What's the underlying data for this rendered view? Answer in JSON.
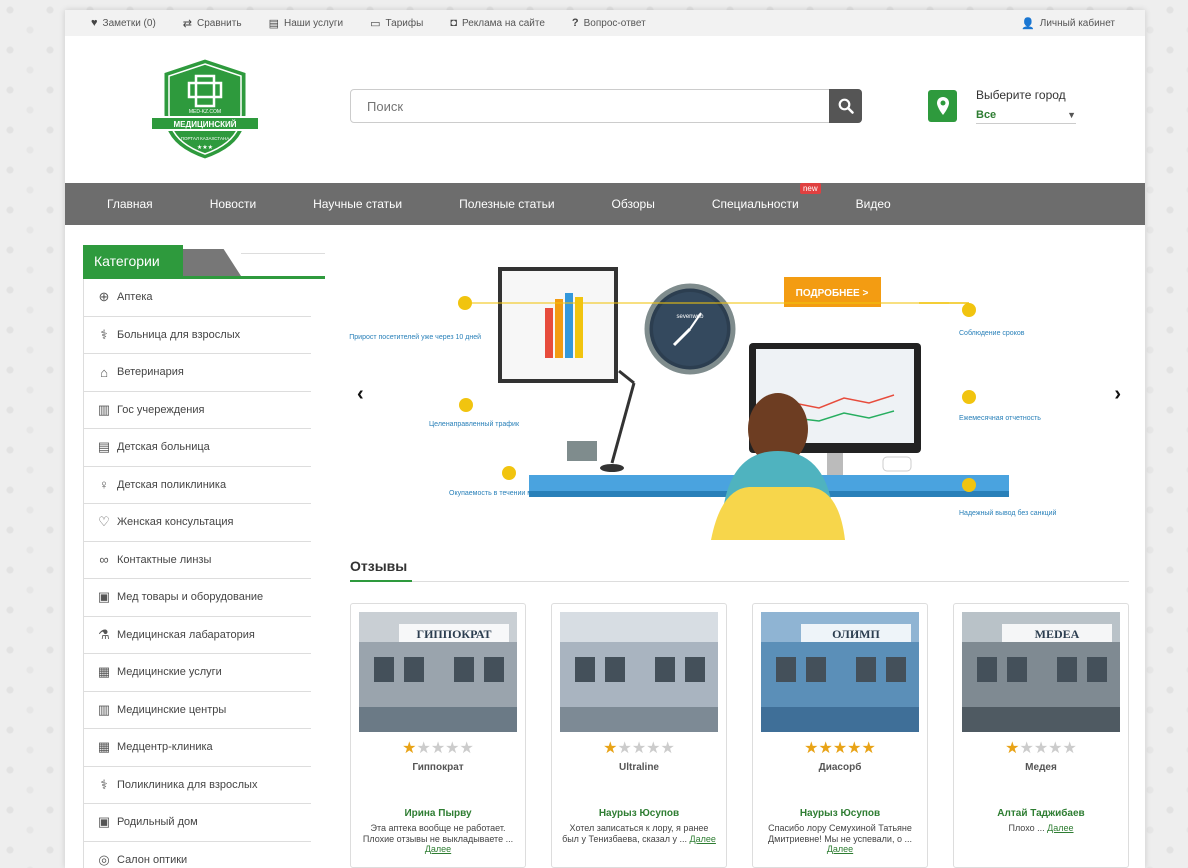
{
  "topbar": {
    "notes": "Заметки (0)",
    "compare": "Сравнить",
    "services": "Наши услуги",
    "tariffs": "Тарифы",
    "ads": "Реклама на сайте",
    "faq": "Вопрос-ответ",
    "account": "Личный кабинет"
  },
  "logo": {
    "line1": "MED-KZ.COM",
    "line2": "МЕДИЦИНСКИЙ",
    "line3": "ПОРТАЛ КАЗАХСТАНА"
  },
  "search": {
    "placeholder": "Поиск"
  },
  "city": {
    "label": "Выберите город",
    "value": "Все"
  },
  "nav": {
    "items": [
      "Главная",
      "Новости",
      "Научные статьи",
      "Полезные статьи",
      "Обзоры",
      "Специальности",
      "Видео"
    ],
    "badge": "new"
  },
  "categories": {
    "title": "Категории",
    "items": [
      {
        "label": "Аптека",
        "icon": "pharmacy-icon"
      },
      {
        "label": "Больница для взрослых",
        "icon": "hospital-icon"
      },
      {
        "label": "Ветеринария",
        "icon": "vet-icon"
      },
      {
        "label": "Гос учереждения",
        "icon": "government-icon"
      },
      {
        "label": "Детская больница",
        "icon": "children-hospital-icon"
      },
      {
        "label": "Детская поликлиника",
        "icon": "child-clinic-icon"
      },
      {
        "label": "Женская консультация",
        "icon": "women-clinic-icon"
      },
      {
        "label": "Контактные линзы",
        "icon": "lens-icon"
      },
      {
        "label": "Мед товары и оборудование",
        "icon": "equipment-icon"
      },
      {
        "label": "Медицинская лабаратория",
        "icon": "laboratory-icon"
      },
      {
        "label": "Медицинские услуги",
        "icon": "services-icon"
      },
      {
        "label": "Медицинские центры",
        "icon": "medical-center-icon"
      },
      {
        "label": "Медцентр-клиника",
        "icon": "clinic-icon"
      },
      {
        "label": "Поликлиника для взрослых",
        "icon": "adult-clinic-icon"
      },
      {
        "label": "Родильный дом",
        "icon": "maternity-icon"
      },
      {
        "label": "Салон оптики",
        "icon": "glasses-icon"
      }
    ]
  },
  "slider": {
    "button": "ПОДРОБНЕЕ >",
    "labels": {
      "growth": "Прирост посетителей уже через 10 дней",
      "deadlines": "Соблюдение сроков",
      "traffic": "Целенаправленный трафик",
      "monthly": "Ежемесячная отчетность",
      "payback": "Окупаемость в течении месяца",
      "sanctions": "Надежный вывод без санкций"
    },
    "clock_brand": "sevenweb"
  },
  "reviews": {
    "title": "Отзывы",
    "more_label": "Далее",
    "cards": [
      {
        "name": "Гиппократ",
        "rating": 1,
        "author": "Ирина Пырву",
        "text": "Эта аптека вообще не работает. Плохие отзывы не выкладываете ...",
        "sign": "ГИППОКРАТ"
      },
      {
        "name": "Ultraline",
        "rating": 1,
        "author": "Наурыз Юсупов",
        "text": "Хотел записаться к лору, я ранее был у Тенизбаева, сказал у ...",
        "sign": ""
      },
      {
        "name": "Диасорб",
        "rating": 5,
        "author": "Наурыз Юсупов",
        "text": "Спасибо лору Семухиной Татьяне Дмитриевне! Мы не успевали, о ...",
        "sign": "ОЛИМП"
      },
      {
        "name": "Медея",
        "rating": 1,
        "author": "Алтай Таджибаев",
        "text": "Плохо ...",
        "sign": "MEDEA"
      }
    ]
  },
  "colors": {
    "accent": "#2e9a3d",
    "nav": "#6d6d6d",
    "star": "#e8a317"
  }
}
